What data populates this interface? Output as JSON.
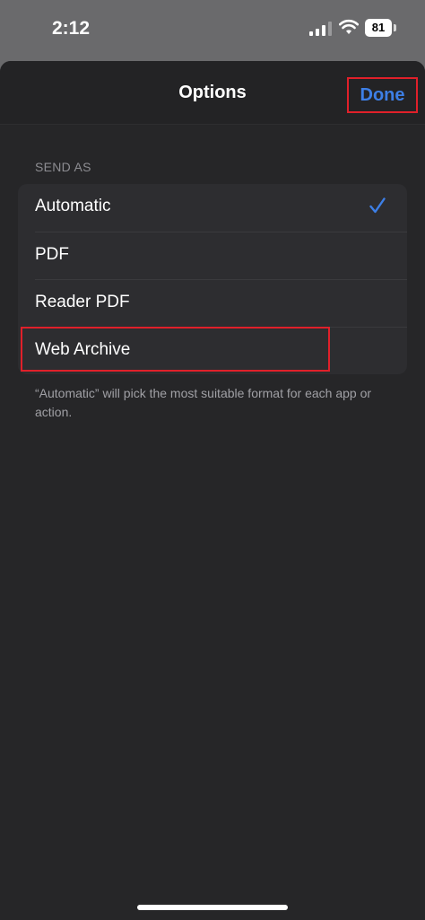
{
  "status_bar": {
    "time": "2:12",
    "battery": "81"
  },
  "nav": {
    "title": "Options",
    "done_label": "Done"
  },
  "section": {
    "header": "SEND AS"
  },
  "options": [
    {
      "label": "Automatic",
      "selected": true
    },
    {
      "label": "PDF",
      "selected": false
    },
    {
      "label": "Reader PDF",
      "selected": false
    },
    {
      "label": "Web Archive",
      "selected": false
    }
  ],
  "footer": {
    "note": "“Automatic” will pick the most suitable format for each app or action."
  },
  "colors": {
    "accent": "#3d7fe6",
    "highlight": "#e0202a",
    "sheet": "#262628"
  }
}
